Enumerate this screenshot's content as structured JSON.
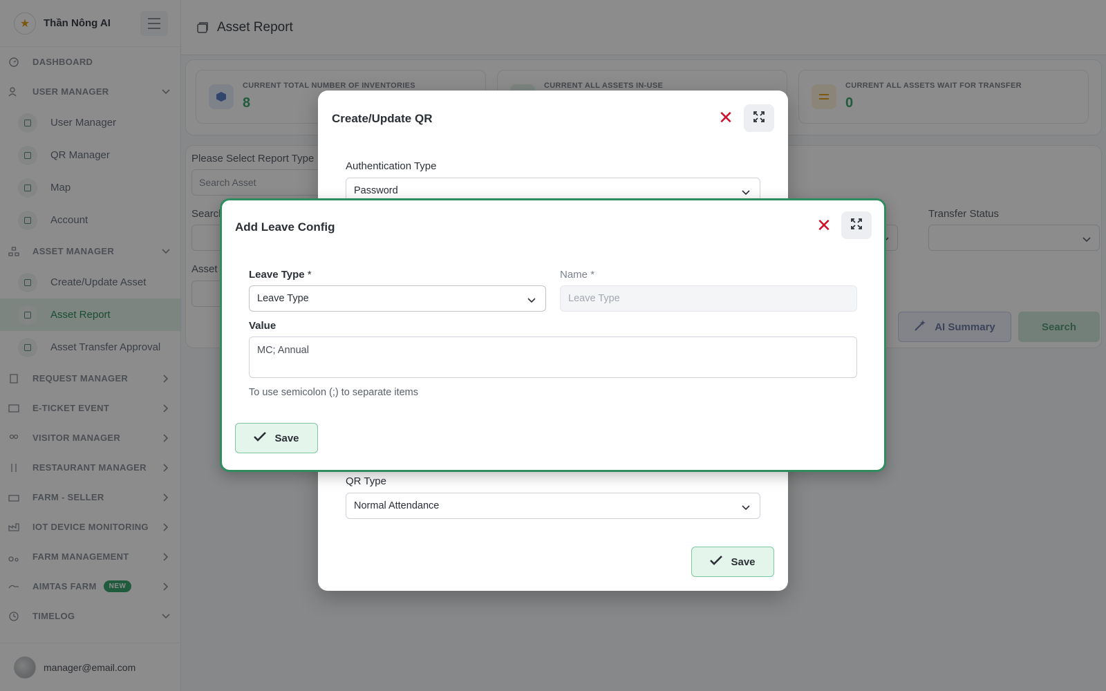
{
  "app": {
    "name": "Thần Nông AI",
    "user_email": "manager@email.com"
  },
  "sidebar": {
    "dashboard": "DASHBOARD",
    "user_manager": {
      "label": "USER MANAGER",
      "items": [
        "User Manager",
        "QR Manager",
        "Map",
        "Account"
      ]
    },
    "asset_manager": {
      "label": "ASSET MANAGER",
      "items": [
        "Create/Update Asset",
        "Asset Report",
        "Asset Transfer Approval"
      ],
      "active": "Asset Report"
    },
    "groups": [
      "REQUEST MANAGER",
      "E-TICKET EVENT",
      "VISITOR MANAGER",
      "RESTAURANT MANAGER",
      "FARM - SELLER",
      "IOT DEVICE MONITORING",
      "FARM MANAGEMENT"
    ],
    "aimtas": {
      "label": "AIMTAS FARM",
      "badge": "NEW"
    },
    "timelog": "TIMELOG"
  },
  "page": {
    "title": "Asset Report"
  },
  "stats": [
    {
      "label": "CURRENT TOTAL NUMBER OF INVENTORIES",
      "value": "8",
      "color": "#5b7fc7"
    },
    {
      "label": "CURRENT ALL ASSETS IN-USE",
      "value": "",
      "color": "#3ba672"
    },
    {
      "label": "CURRENT ALL ASSETS WAIT FOR TRANSFER",
      "value": "0",
      "color": "#e0a11b"
    }
  ],
  "filters": {
    "report_type_label": "Please Select Report Type",
    "search_asset_placeholder": "Search Asset",
    "search_label": "Search",
    "asset_label": "Asset",
    "transfer_status_label": "Transfer Status",
    "ai_summary": "AI Summary",
    "search_button": "Search"
  },
  "qr_modal": {
    "title": "Create/Update QR",
    "auth_type_label": "Authentication Type",
    "auth_type_value": "Password",
    "qr_type_label": "QR Type",
    "qr_type_value": "Normal Attendance",
    "save": "Save"
  },
  "leave_modal": {
    "title": "Add Leave Config",
    "leave_type_label": "Leave Type",
    "leave_type_value": "Leave Type",
    "name_label": "Name",
    "name_placeholder": "Leave Type",
    "required_mark": "*",
    "value_label": "Value",
    "value_text": "MC; Annual",
    "hint": "To use semicolon (;) to separate items",
    "save": "Save"
  },
  "colors": {
    "accent": "#2f8c5f",
    "close": "#d0102b",
    "active_bg": "#e3f3ea"
  }
}
